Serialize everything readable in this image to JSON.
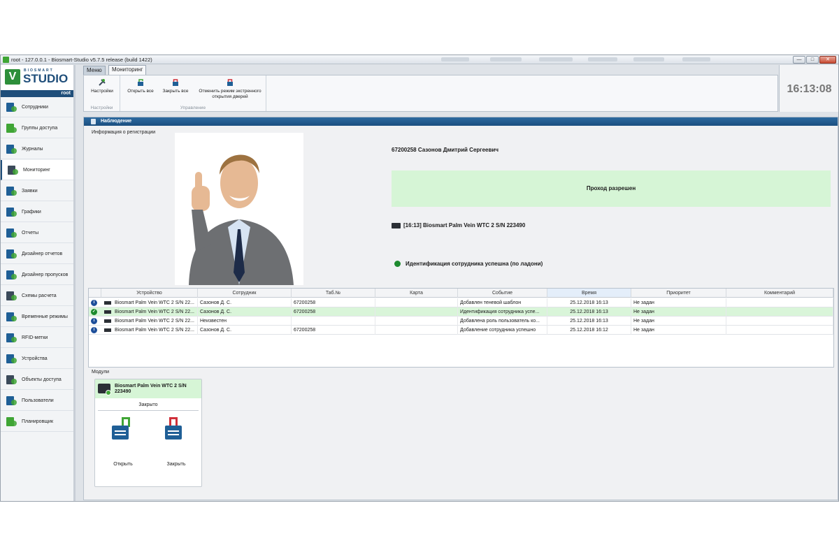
{
  "window": {
    "title": "root - 127.0.0.1 - Biosmart-Studio v5.7.5 release (build 1422)",
    "controls": [
      "—",
      "□",
      "✕"
    ]
  },
  "logo": {
    "top_text": "BIOSMART",
    "brand": "STUDIO",
    "mark": "V"
  },
  "user": "root",
  "sidebar": {
    "items": [
      {
        "label": "Сотрудники",
        "icon": "employees-icon"
      },
      {
        "label": "Группы доступа",
        "icon": "access-groups-icon"
      },
      {
        "label": "Журналы",
        "icon": "journals-icon"
      },
      {
        "label": "Мониторинг",
        "icon": "monitoring-icon",
        "active": true
      },
      {
        "label": "Заявки",
        "icon": "requests-icon"
      },
      {
        "label": "Графики",
        "icon": "schedules-icon"
      },
      {
        "label": "Отчеты",
        "icon": "reports-icon"
      },
      {
        "label": "Дизайнер отчетов",
        "icon": "report-designer-icon"
      },
      {
        "label": "Дизайнер пропусков",
        "icon": "pass-designer-icon"
      },
      {
        "label": "Схемы расчета",
        "icon": "calculation-schemes-icon"
      },
      {
        "label": "Временные режимы",
        "icon": "time-modes-icon"
      },
      {
        "label": "RFID-метки",
        "icon": "rfid-tags-icon"
      },
      {
        "label": "Устройства",
        "icon": "devices-icon"
      },
      {
        "label": "Объекты доступа",
        "icon": "access-objects-icon"
      },
      {
        "label": "Пользователи",
        "icon": "users-icon"
      },
      {
        "label": "Планировщик",
        "icon": "scheduler-icon"
      }
    ]
  },
  "tabs": [
    {
      "label": "Меню"
    },
    {
      "label": "Мониторинг",
      "active": true
    }
  ],
  "ribbon": {
    "groups": [
      {
        "label": "Настройки",
        "buttons": [
          "Настройки"
        ]
      },
      {
        "label": "Управление",
        "buttons": [
          "Открыть все",
          "Закрыть все",
          "Отменить режим экстренного открытия дверей"
        ]
      }
    ]
  },
  "clock": "16:13:08",
  "panel": {
    "title": "Наблюдение",
    "registration_label": "Информация о регистрации",
    "employee": "67200258 Сазонов Дмитрий Сергеевич",
    "status": "Проход разрешен",
    "device": "[16:13] Biosmart Palm Vein WTC 2 S/N 223490",
    "identification": "Идентификация сотрудника успешна (по ладони)"
  },
  "table": {
    "columns": [
      "Устройство",
      "Сотрудник",
      "Таб.№",
      "Карта",
      "Событие",
      "Время",
      "Приоритет",
      "Комментарий"
    ],
    "rows": [
      {
        "type": "info",
        "device": "Biosmart Palm Vein WTC 2 S/N 22...",
        "employee": "Сазонов Д. С.",
        "tab": "67200258",
        "card": "",
        "event": "Добавлен теневой шаблон",
        "time": "25.12.2018 16:13",
        "priority": "Не задан",
        "comment": ""
      },
      {
        "type": "ok",
        "device": "Biosmart Palm Vein WTC 2 S/N 22...",
        "employee": "Сазонов Д. С.",
        "tab": "67200258",
        "card": "",
        "event": "Идентификация сотрудника успе...",
        "time": "25.12.2018 16:13",
        "priority": "Не задан",
        "comment": ""
      },
      {
        "type": "info",
        "device": "Biosmart Palm Vein WTC 2 S/N 22...",
        "employee": "Неизвестен",
        "tab": "",
        "card": "",
        "event": "Добавлена роль пользователь ко...",
        "time": "25.12.2018 16:13",
        "priority": "Не задан",
        "comment": ""
      },
      {
        "type": "info",
        "device": "Biosmart Palm Vein WTC 2 S/N 22...",
        "employee": "Сазонов Д. С.",
        "tab": "67200258",
        "card": "",
        "event": "Добавление сотрудника успешно",
        "time": "25.12.2018 16:12",
        "priority": "Не задан",
        "comment": ""
      }
    ]
  },
  "modules": {
    "label": "Модули",
    "card": {
      "name": "Biosmart Palm Vein WTC 2 S/N 223490",
      "state": "Закрыто",
      "open_label": "Открыть",
      "close_label": "Закрыть"
    }
  },
  "colors": {
    "accent": "#1f4e7a",
    "success_bg": "#d6f5d6",
    "brand_green": "#2d8f3a"
  }
}
